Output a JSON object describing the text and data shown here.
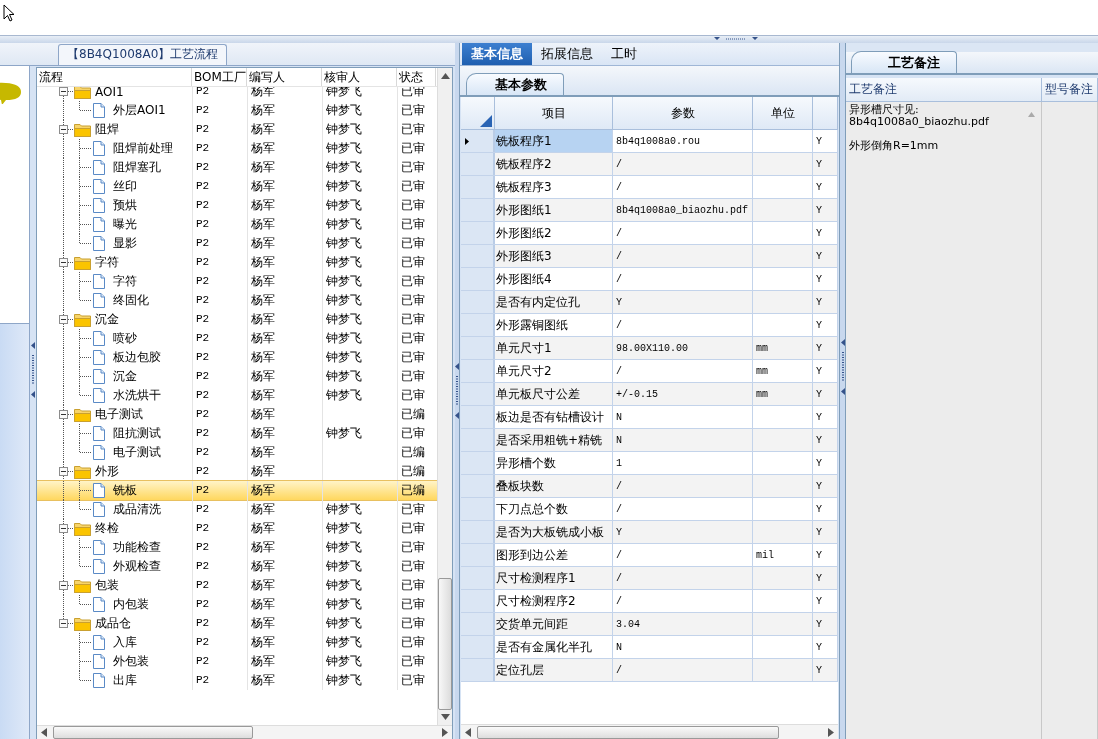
{
  "process_panel": {
    "title": "【8B4Q1008A0】工艺流程",
    "columns": [
      "流程",
      "BOM工厂",
      "编写人",
      "核审人",
      "状态"
    ],
    "tree": [
      {
        "name": "AOI1",
        "plant": "P2",
        "writer": "杨军",
        "reviewer": "钟梦飞",
        "status": "已审",
        "expanded": true,
        "selected": false,
        "children": [
          {
            "name": "外层AOI1",
            "plant": "P2",
            "writer": "杨军",
            "reviewer": "钟梦飞",
            "status": "已审",
            "selected": false
          }
        ]
      },
      {
        "name": "阻焊",
        "plant": "P2",
        "writer": "杨军",
        "reviewer": "钟梦飞",
        "status": "已审",
        "expanded": true,
        "selected": false,
        "children": [
          {
            "name": "阻焊前处理",
            "plant": "P2",
            "writer": "杨军",
            "reviewer": "钟梦飞",
            "status": "已审",
            "selected": false
          },
          {
            "name": "阻焊塞孔",
            "plant": "P2",
            "writer": "杨军",
            "reviewer": "钟梦飞",
            "status": "已审",
            "selected": false
          },
          {
            "name": "丝印",
            "plant": "P2",
            "writer": "杨军",
            "reviewer": "钟梦飞",
            "status": "已审",
            "selected": false
          },
          {
            "name": "预烘",
            "plant": "P2",
            "writer": "杨军",
            "reviewer": "钟梦飞",
            "status": "已审",
            "selected": false
          },
          {
            "name": "曝光",
            "plant": "P2",
            "writer": "杨军",
            "reviewer": "钟梦飞",
            "status": "已审",
            "selected": false
          },
          {
            "name": "显影",
            "plant": "P2",
            "writer": "杨军",
            "reviewer": "钟梦飞",
            "status": "已审",
            "selected": false
          }
        ]
      },
      {
        "name": "字符",
        "plant": "P2",
        "writer": "杨军",
        "reviewer": "钟梦飞",
        "status": "已审",
        "expanded": true,
        "selected": false,
        "children": [
          {
            "name": "字符",
            "plant": "P2",
            "writer": "杨军",
            "reviewer": "钟梦飞",
            "status": "已审",
            "selected": false
          },
          {
            "name": "终固化",
            "plant": "P2",
            "writer": "杨军",
            "reviewer": "钟梦飞",
            "status": "已审",
            "selected": false
          }
        ]
      },
      {
        "name": "沉金",
        "plant": "P2",
        "writer": "杨军",
        "reviewer": "钟梦飞",
        "status": "已审",
        "expanded": true,
        "selected": false,
        "children": [
          {
            "name": "喷砂",
            "plant": "P2",
            "writer": "杨军",
            "reviewer": "钟梦飞",
            "status": "已审",
            "selected": false
          },
          {
            "name": "板边包胶",
            "plant": "P2",
            "writer": "杨军",
            "reviewer": "钟梦飞",
            "status": "已审",
            "selected": false
          },
          {
            "name": "沉金",
            "plant": "P2",
            "writer": "杨军",
            "reviewer": "钟梦飞",
            "status": "已审",
            "selected": false
          },
          {
            "name": "水洗烘干",
            "plant": "P2",
            "writer": "杨军",
            "reviewer": "钟梦飞",
            "status": "已审",
            "selected": false
          }
        ]
      },
      {
        "name": "电子测试",
        "plant": "P2",
        "writer": "杨军",
        "status": "已编",
        "expanded": true,
        "selected": false,
        "children": [
          {
            "name": "阻抗测试",
            "plant": "P2",
            "writer": "杨军",
            "reviewer": "钟梦飞",
            "status": "已审",
            "selected": false
          },
          {
            "name": "电子测试",
            "plant": "P2",
            "writer": "杨军",
            "status": "已编",
            "selected": false
          }
        ]
      },
      {
        "name": "外形",
        "plant": "P2",
        "writer": "杨军",
        "status": "已编",
        "expanded": true,
        "selected": false,
        "children": [
          {
            "name": "铣板",
            "plant": "P2",
            "writer": "杨军",
            "status": "已编",
            "selected": true
          },
          {
            "name": "成品清洗",
            "plant": "P2",
            "writer": "杨军",
            "reviewer": "钟梦飞",
            "status": "已审",
            "selected": false
          }
        ]
      },
      {
        "name": "终检",
        "plant": "P2",
        "writer": "杨军",
        "reviewer": "钟梦飞",
        "status": "已审",
        "expanded": true,
        "selected": false,
        "children": [
          {
            "name": "功能检查",
            "plant": "P2",
            "writer": "杨军",
            "reviewer": "钟梦飞",
            "status": "已审",
            "selected": false
          },
          {
            "name": "外观检查",
            "plant": "P2",
            "writer": "杨军",
            "reviewer": "钟梦飞",
            "status": "已审",
            "selected": false
          }
        ]
      },
      {
        "name": "包装",
        "plant": "P2",
        "writer": "杨军",
        "reviewer": "钟梦飞",
        "status": "已审",
        "expanded": true,
        "selected": false,
        "children": [
          {
            "name": "内包装",
            "plant": "P2",
            "writer": "杨军",
            "reviewer": "钟梦飞",
            "status": "已审",
            "selected": false
          }
        ]
      },
      {
        "name": "成品仓",
        "plant": "P2",
        "writer": "杨军",
        "reviewer": "钟梦飞",
        "status": "已审",
        "expanded": true,
        "selected": false,
        "children": [
          {
            "name": "入库",
            "plant": "P2",
            "writer": "杨军",
            "reviewer": "钟梦飞",
            "status": "已审",
            "selected": false
          },
          {
            "name": "外包装",
            "plant": "P2",
            "writer": "杨军",
            "reviewer": "钟梦飞",
            "status": "已审",
            "selected": false
          },
          {
            "name": "出库",
            "plant": "P2",
            "writer": "杨军",
            "reviewer": "钟梦飞",
            "status": "已审",
            "selected": false
          }
        ]
      }
    ]
  },
  "info_panel": {
    "tabs": [
      {
        "label": "基本信息",
        "selected": true
      },
      {
        "label": "拓展信息",
        "selected": false
      },
      {
        "label": "工时",
        "selected": false
      }
    ],
    "sub_tab": "基本参数",
    "columns": [
      "项目",
      "参数",
      "单位"
    ],
    "rows": [
      {
        "item": "铣板程序1",
        "value": "8b4q1008a0.rou",
        "column_4": "Y",
        "selected": true
      },
      {
        "item": "铣板程序2",
        "value": "/",
        "column_4": "Y",
        "selected": false
      },
      {
        "item": "铣板程序3",
        "value": "/",
        "column_4": "Y",
        "selected": false
      },
      {
        "item": "外形图纸1",
        "value": "8b4q1008a0_biaozhu.pdf",
        "column_4": "Y",
        "selected": false
      },
      {
        "item": "外形图纸2",
        "value": "/",
        "column_4": "Y",
        "selected": false
      },
      {
        "item": "外形图纸3",
        "value": "/",
        "column_4": "Y",
        "selected": false
      },
      {
        "item": "外形图纸4",
        "value": "/",
        "column_4": "Y",
        "selected": false
      },
      {
        "item": "是否有内定位孔",
        "value": "Y",
        "column_4": "Y",
        "selected": false
      },
      {
        "item": "外形露铜图纸",
        "value": "/",
        "column_4": "Y",
        "selected": false
      },
      {
        "item": "单元尺寸1",
        "value": "98.00X110.00",
        "unit": "mm",
        "column_4": "Y",
        "selected": false
      },
      {
        "item": "单元尺寸2",
        "value": "/",
        "unit": "mm",
        "column_4": "Y",
        "selected": false
      },
      {
        "item": "单元板尺寸公差",
        "value": "+/-0.15",
        "unit": "mm",
        "column_4": "Y",
        "selected": false
      },
      {
        "item": "板边是否有钻槽设计",
        "value": "N",
        "column_4": "Y",
        "selected": false
      },
      {
        "item": "是否采用粗铣+精铣",
        "value": "N",
        "column_4": "Y",
        "selected": false
      },
      {
        "item": "异形槽个数",
        "value": "1",
        "column_4": "Y",
        "selected": false
      },
      {
        "item": "叠板块数",
        "value": "/",
        "column_4": "Y",
        "selected": false
      },
      {
        "item": "下刀点总个数",
        "value": "/",
        "column_4": "Y",
        "selected": false
      },
      {
        "item": "是否为大板铣成小板",
        "value": "Y",
        "column_4": "Y",
        "selected": false
      },
      {
        "item": "图形到边公差",
        "value": "/",
        "unit": "mil",
        "column_4": "Y",
        "selected": false
      },
      {
        "item": "尺寸检测程序1",
        "value": "/",
        "column_4": "Y",
        "selected": false
      },
      {
        "item": "尺寸检测程序2",
        "value": "/",
        "column_4": "Y",
        "selected": false
      },
      {
        "item": "交货单元间距",
        "value": "3.04",
        "column_4": "Y",
        "selected": false
      },
      {
        "item": "是否有金属化半孔",
        "value": "N",
        "column_4": "Y",
        "selected": false
      },
      {
        "item": "定位孔层",
        "value": "/",
        "column_4": "Y",
        "selected": false
      }
    ]
  },
  "notes_panel": {
    "tab": "工艺备注",
    "columns": [
      "工艺备注",
      "型号备注"
    ],
    "note": "异形槽尺寸见:\n8b4q1008a0_biaozhu.pdf\n\n外形倒角R=1mm"
  }
}
